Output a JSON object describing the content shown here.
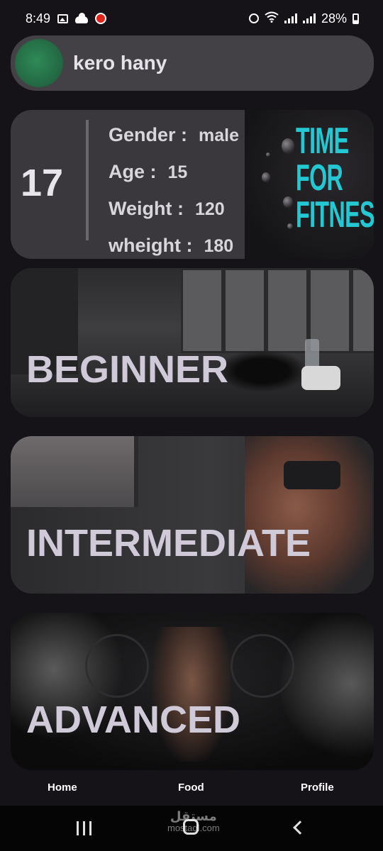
{
  "status_bar": {
    "time": "8:49",
    "battery": "28%",
    "icons": [
      "image-icon",
      "cloud-icon",
      "app-badge-icon",
      "alarm-icon",
      "wifi-icon",
      "signal-icon",
      "battery-icon"
    ]
  },
  "profile": {
    "name": "kero hany",
    "avatar_color": "#2f8a57"
  },
  "stats": {
    "number": "17",
    "rows": [
      {
        "label": "Gender :",
        "value": "male"
      },
      {
        "label": "Age :",
        "value": "15"
      },
      {
        "label": "Weight :",
        "value": "120"
      },
      {
        "label": "wheight :",
        "value": "180"
      }
    ],
    "poster_lines": [
      "TIME",
      "FOR",
      "FITNESS"
    ],
    "poster_color": "#23c8d3"
  },
  "levels": {
    "beginner": "BEGINNER",
    "intermediate": "INTERMEDIATE",
    "advanced": "ADVANCED"
  },
  "bottom_nav": {
    "items": [
      {
        "label": "Home"
      },
      {
        "label": "Food"
      },
      {
        "label": "Profile"
      }
    ]
  },
  "watermark": {
    "arabic": "مستقل",
    "latin": "mostaql.com"
  },
  "colors": {
    "background": "#161318",
    "card": "#3a383c",
    "level_text": "#cfc9d8"
  }
}
